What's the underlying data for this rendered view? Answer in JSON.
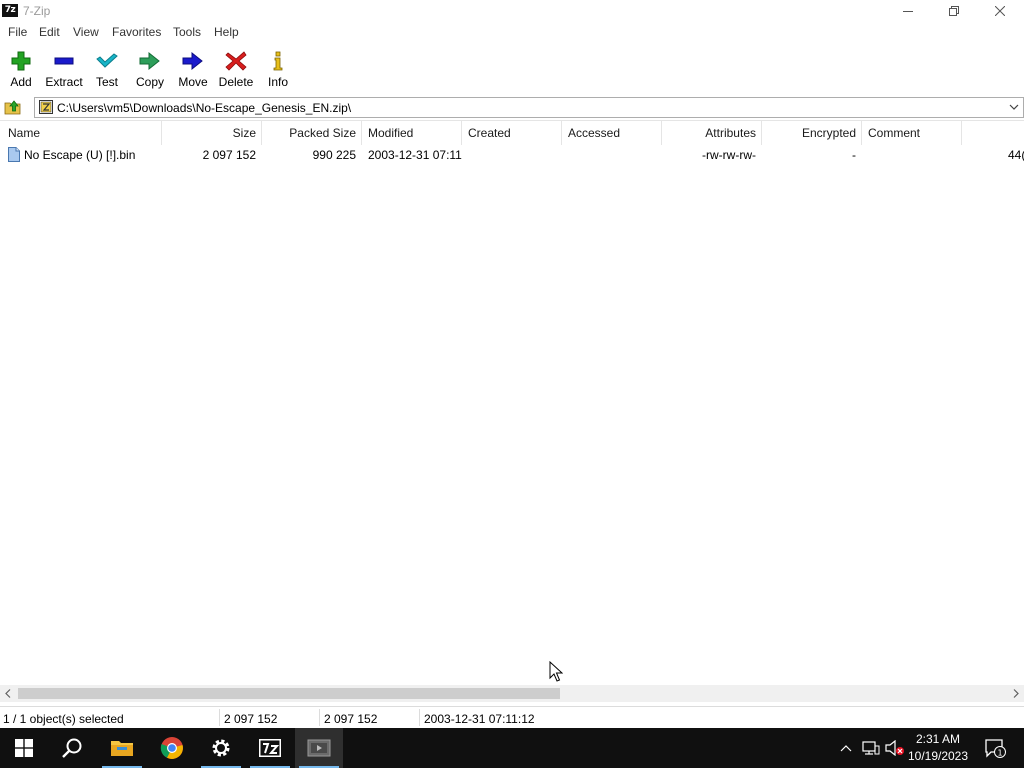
{
  "window": {
    "app_icon_text": "7z",
    "title": "7-Zip"
  },
  "menu": [
    "File",
    "Edit",
    "View",
    "Favorites",
    "Tools",
    "Help"
  ],
  "toolbar": {
    "add": "Add",
    "extract": "Extract",
    "test": "Test",
    "copy": "Copy",
    "move": "Move",
    "delete": "Delete",
    "info": "Info"
  },
  "address": {
    "path": "C:\\Users\\vm5\\Downloads\\No-Escape_Genesis_EN.zip\\"
  },
  "columns": [
    "Name",
    "Size",
    "Packed Size",
    "Modified",
    "Created",
    "Accessed",
    "Attributes",
    "Encrypted",
    "Comment"
  ],
  "files": [
    {
      "name": "No Escape (U) [!].bin",
      "size": "2 097 152",
      "packed_size": "990 225",
      "modified": "2003-12-31 07:11",
      "created": "",
      "accessed": "",
      "attributes": "-rw-rw-rw-",
      "encrypted": "-",
      "comment": "",
      "overflow": "44("
    }
  ],
  "status": {
    "selection": "1 / 1 object(s) selected",
    "size": "2 097 152",
    "packed": "2 097 152",
    "modified": "2003-12-31 07:11:12"
  },
  "taskbar": {
    "clock_time": "2:31 AM",
    "clock_date": "10/19/2023",
    "notification_count": "1",
    "apps": [
      "start-icon",
      "search-icon",
      "file-explorer-icon",
      "chrome-icon",
      "settings-icon",
      "7zip-icon",
      "media-app-icon"
    ]
  },
  "colors": {
    "add_green": "#22a322",
    "extract_blue": "#1a1acc",
    "test_cyan": "#18b5c8",
    "delete_red": "#d81e1e",
    "taskbar": "#101010",
    "scroll_thumb": "#cdcdcd"
  }
}
